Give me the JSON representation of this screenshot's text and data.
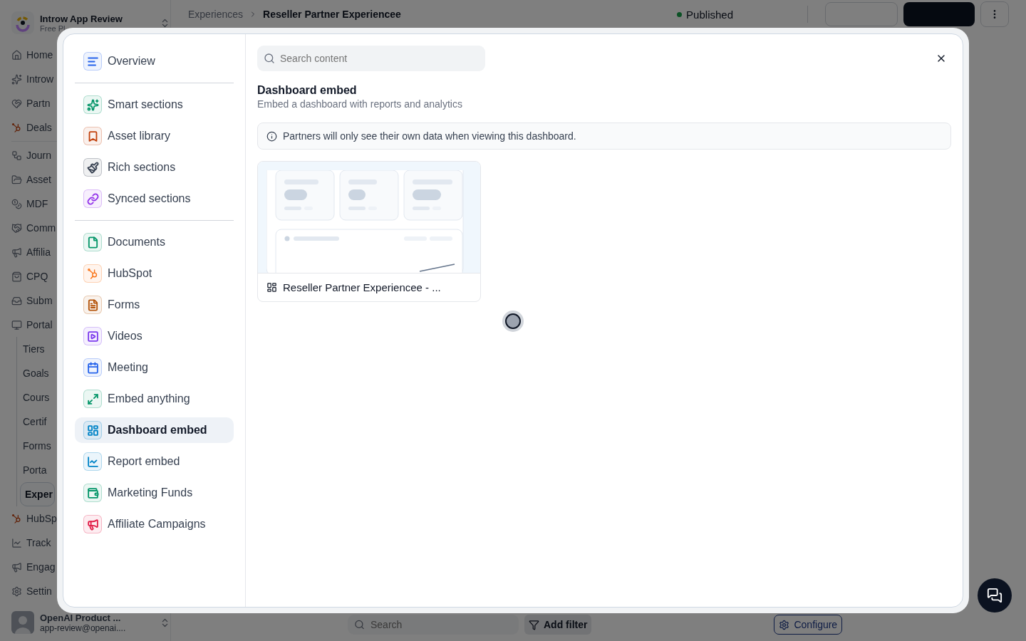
{
  "app_sidebar": {
    "workspace": {
      "name": "Introw App Review",
      "plan": "Free Pl"
    },
    "groups": [
      [
        {
          "label": "Home",
          "selected": false
        },
        {
          "label": "Introw",
          "selected": false
        },
        {
          "label": "Partn",
          "selected": false
        },
        {
          "label": "Deals",
          "selected": false
        }
      ],
      [
        {
          "label": "Journ",
          "selected": false
        },
        {
          "label": "Asset",
          "selected": false
        },
        {
          "label": "MDF",
          "selected": false
        },
        {
          "label": "Comm",
          "selected": false
        },
        {
          "label": "Affilia",
          "selected": false
        },
        {
          "label": "CPQ",
          "selected": false
        },
        {
          "label": "Subm",
          "selected": false
        },
        {
          "label": "Portal",
          "selected": false,
          "children": [
            {
              "label": "Tiers",
              "selected": false
            },
            {
              "label": "Goals",
              "selected": false
            },
            {
              "label": "Cours",
              "selected": false
            },
            {
              "label": "Certif",
              "selected": false
            },
            {
              "label": "Forms",
              "selected": false
            },
            {
              "label": "Porta",
              "selected": false
            },
            {
              "label": "Exper",
              "selected": true
            }
          ]
        },
        {
          "label": "HubSp",
          "selected": false
        },
        {
          "label": "Track",
          "selected": false
        },
        {
          "label": "Engag",
          "selected": false
        },
        {
          "label": "Settin",
          "selected": false
        }
      ]
    ],
    "user": {
      "name": "OpenAI Product ...",
      "email": "app-review@openai...."
    }
  },
  "header": {
    "breadcrumb": [
      "Experiences",
      "Reseller Partner Experiencee"
    ],
    "status": "Published"
  },
  "toolbar": {
    "search_placeholder": "Search",
    "filter": "Add filter",
    "configure": "Configure"
  },
  "modal": {
    "nav_groups": [
      [
        {
          "label": "Overview",
          "color": "#2563eb",
          "selected": false
        }
      ],
      [
        {
          "label": "Smart sections",
          "color": "#059669",
          "selected": false
        },
        {
          "label": "Asset library",
          "color": "#c2410c",
          "selected": false
        },
        {
          "label": "Rich sections",
          "color": "#374151",
          "selected": false
        },
        {
          "label": "Synced sections",
          "color": "#9333ea",
          "selected": false
        }
      ],
      [
        {
          "label": "Documents",
          "color": "#059669",
          "selected": false
        },
        {
          "label": "HubSpot",
          "color": "#f97316",
          "selected": false
        },
        {
          "label": "Forms",
          "color": "#b45309",
          "selected": false
        },
        {
          "label": "Videos",
          "color": "#7c3aed",
          "selected": false
        },
        {
          "label": "Meeting",
          "color": "#2563eb",
          "selected": false
        },
        {
          "label": "Embed anything",
          "color": "#059669",
          "selected": false
        },
        {
          "label": "Dashboard embed",
          "color": "#0284c7",
          "selected": true
        },
        {
          "label": "Report embed",
          "color": "#0284c7",
          "selected": false
        },
        {
          "label": "Marketing Funds",
          "color": "#059669",
          "selected": false
        },
        {
          "label": "Affiliate Campaigns",
          "color": "#e11d48",
          "selected": false
        }
      ]
    ],
    "search_placeholder": "Search content",
    "title": "Dashboard embed",
    "subtitle": "Embed a dashboard with reports and analytics",
    "notice": "Partners will only see their own data when viewing this dashboard.",
    "cards": [
      {
        "title": "Reseller Partner Experiencee - ..."
      }
    ]
  }
}
